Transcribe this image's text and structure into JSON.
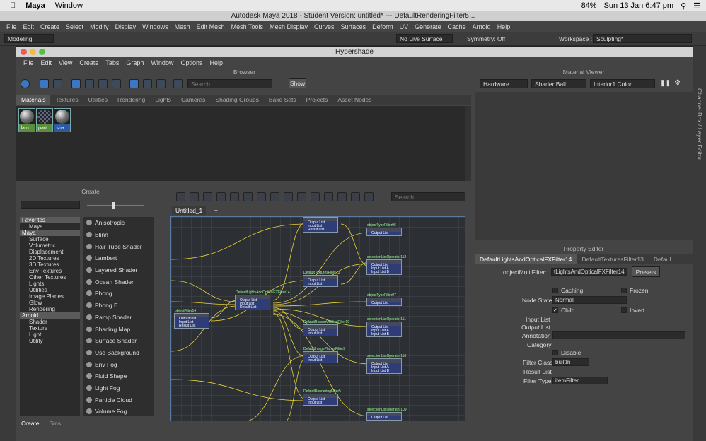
{
  "os": {
    "app": "Maya",
    "menu": "Window",
    "battery": "84%",
    "datetime": "Sun 13 Jan  6:47 pm"
  },
  "maya": {
    "title": "Autodesk Maya 2018 - Student Version: untitled*   ---   DefaultRenderingFilter5...",
    "menu": [
      "File",
      "Edit",
      "Create",
      "Select",
      "Modify",
      "Display",
      "Windows",
      "Mesh",
      "Edit Mesh",
      "Mesh Tools",
      "Mesh Display",
      "Curves",
      "Surfaces",
      "Deform",
      "UV",
      "Generate",
      "Cache",
      "Arnold",
      "Help"
    ],
    "menuset": "Modeling",
    "live_surface": "No Live Surface",
    "symmetry": "Symmetry: Off",
    "workspace_label": "Workspace :",
    "workspace": "Sculpting*",
    "right_strip": "Channel Box / Layer Editor"
  },
  "hypershade": {
    "title": "Hypershade",
    "menu": [
      "File",
      "Edit",
      "View",
      "Create",
      "Tabs",
      "Graph",
      "Window",
      "Options",
      "Help"
    ],
    "browser": {
      "title": "Browser",
      "search_placeholder": "Search...",
      "show_label": "Show",
      "tabs": [
        "Materials",
        "Textures",
        "Utilities",
        "Rendering",
        "Lights",
        "Cameras",
        "Shading Groups",
        "Bake Sets",
        "Projects",
        "Asset Nodes"
      ],
      "swatches": [
        "lam...",
        "part...",
        "sha..."
      ]
    },
    "create": {
      "title": "Create",
      "tree": [
        "Favorites",
        "Maya",
        "Maya",
        "Surface",
        "Volumetric",
        "Displacement",
        "2D Textures",
        "3D Textures",
        "Env Textures",
        "Other Textures",
        "Lights",
        "Utilities",
        "Image Planes",
        "Glow",
        "Rendering",
        "Arnold",
        "Shader",
        "Texture",
        "Light",
        "Utility"
      ],
      "nodes": [
        "Anisotropic",
        "Blinn",
        "Hair Tube Shader",
        "Lambert",
        "Layered Shader",
        "Ocean Shader",
        "Phong",
        "Phong E",
        "Ramp Shader",
        "Shading Map",
        "Surface Shader",
        "Use Background",
        "Env Fog",
        "Fluid Shape",
        "Light Fog",
        "Particle Cloud",
        "Volume Fog"
      ],
      "bottom_tabs": [
        "Create",
        "Bins"
      ]
    },
    "graph": {
      "search_placeholder": "Search...",
      "tab": "Untitled_1",
      "add_tab": "+",
      "nodes": [
        {
          "title": "",
          "rows": [
            "Output List",
            "Input List",
            "Result List"
          ]
        },
        {
          "title": "objectTypeFilter96",
          "rows": [
            "Output List"
          ]
        },
        {
          "title": "selectionListOperator112",
          "rows": [
            "Output List",
            "Input List A",
            "Input List B"
          ]
        },
        {
          "title": "DefaultTexturesFilter13",
          "rows": [
            "Output List",
            "Input List"
          ]
        },
        {
          "title": "DefaultLightsAndOpticalFXFilter14",
          "rows": [
            "Output List",
            "Input List",
            "Result List"
          ]
        },
        {
          "title": "objectFilter14",
          "rows": [
            "Output List",
            "Input List",
            "Result List"
          ]
        },
        {
          "title": "objectTypeFilter97",
          "rows": [
            "Output List"
          ]
        },
        {
          "title": "DefaultRenderUtilitiesFilter10",
          "rows": [
            "Output List",
            "Input List"
          ]
        },
        {
          "title": "selectionListOperator111",
          "rows": [
            "Output List",
            "Input List A",
            "Input List B"
          ]
        },
        {
          "title": "DefaultImagePlanesFilter9",
          "rows": [
            "Output List",
            "Input List"
          ]
        },
        {
          "title": "selectionListOperator110",
          "rows": [
            "Output List",
            "Input List A",
            "Input List B"
          ]
        },
        {
          "title": "DefaultRenderingFilter5",
          "rows": [
            "Output List",
            "Input List"
          ]
        },
        {
          "title": "selectionListOperator109",
          "rows": [
            "Output List"
          ]
        }
      ]
    },
    "material_viewer": {
      "title": "Material Viewer",
      "renderer": "Hardware",
      "geometry": "Shader Ball",
      "environment": "Interior1 Color"
    },
    "property_editor": {
      "title": "Property Editor",
      "tabs": [
        "DefaultLightsAndOpticalFXFilter14",
        "DefaultTexturesFilter13",
        "Defaul"
      ],
      "object_label": "objectMultiFilter:",
      "object_value": "tLightsAndOpticalFXFilter14",
      "presets": "Presets",
      "caching": "Caching",
      "frozen": "Frozen",
      "node_state_label": "Node State",
      "node_state": "Normal",
      "child": "Child",
      "invert": "Invert",
      "input_list": "Input List",
      "output_list": "Output List",
      "annotation": "Annotation",
      "category": "Category",
      "disable": "Disable",
      "filter_class_label": "Filter Class",
      "filter_class": "builtIn",
      "result_list": "Result List",
      "filter_type_label": "Filter Type",
      "filter_type": "itemFilter"
    }
  },
  "colors": {
    "accent": "#3b78c4",
    "node_body": "#2e3d78",
    "wire": "#e8d33a"
  }
}
